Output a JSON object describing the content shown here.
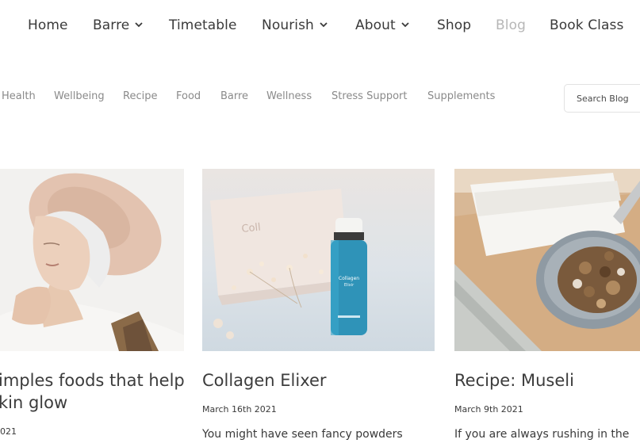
{
  "nav": {
    "items": [
      {
        "label": "Home",
        "dropdown": false
      },
      {
        "label": "Barre",
        "dropdown": true
      },
      {
        "label": "Timetable",
        "dropdown": false
      },
      {
        "label": "Nourish",
        "dropdown": true
      },
      {
        "label": "About",
        "dropdown": true
      },
      {
        "label": "Shop",
        "dropdown": false
      },
      {
        "label": "Blog",
        "dropdown": false,
        "active": true
      },
      {
        "label": "Book Class",
        "dropdown": false
      }
    ]
  },
  "categories": [
    "Health",
    "Wellbeing",
    "Recipe",
    "Food",
    "Barre",
    "Wellness",
    "Stress Support",
    "Supplements"
  ],
  "search": {
    "placeholder": "Search Blog"
  },
  "posts": [
    {
      "title_line1": "imples foods that help",
      "title_line2": "kin glow",
      "date": "021",
      "excerpt": ""
    },
    {
      "title_line1": "Collagen Elixer",
      "title_line2": "",
      "date": "March 16th 2021",
      "excerpt": "You might have seen fancy powders"
    },
    {
      "title_line1": "Recipe: Museli",
      "title_line2": "",
      "date": "March 9th 2021",
      "excerpt": "If you are always rushing in the"
    }
  ],
  "images": [
    {
      "name": "elderly-woman-in-hat-photo"
    },
    {
      "name": "collagen-elixir-bottle-photo",
      "bottle_text": "Collagen Elixir"
    },
    {
      "name": "muesli-bowl-photo"
    }
  ],
  "colors": {
    "nav_text": "#3a3a3a",
    "nav_active": "#b7b7b7",
    "category_text": "#8a8a8a",
    "bottle": "#2f93b8"
  }
}
